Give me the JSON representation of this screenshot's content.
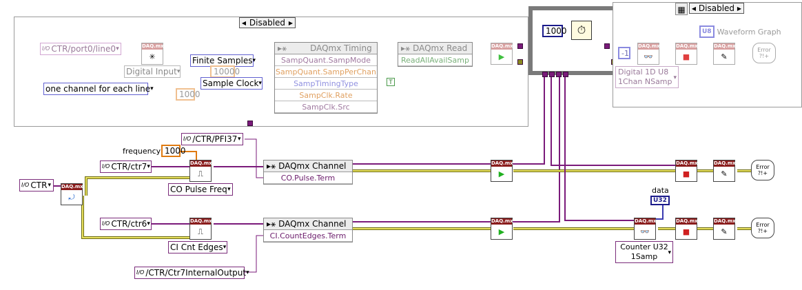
{
  "diagram_disable_structure_1": {
    "selector": "Disabled"
  },
  "diagram_disable_structure_2": {
    "selector": "Disabled"
  },
  "ctr_line": "CTR/port0/line0",
  "digital_input": "Digital Input",
  "one_channel": "one channel for each line",
  "finite_samples": "Finite Samples",
  "samples_per_chan": "10000",
  "sample_clock": "Sample Clock",
  "rate_const": "1000",
  "timing_node": {
    "title": "DAQmx Timing",
    "rows": [
      "SampQuant.SampMode",
      "SampQuant.SampPerChan",
      "SampTimingType",
      "SampClk.Rate",
      "SampClk.Src"
    ]
  },
  "read_node": {
    "title": "DAQmx Read",
    "rows": [
      "ReadAllAvailSamp"
    ]
  },
  "t_const": "T",
  "wait_const": "1000",
  "minus_one": "-1",
  "u8_label": "U8",
  "waveform_graph": "Waveform Graph",
  "digital_1d": [
    "Digital 1D U8",
    "1Chan NSamp"
  ],
  "pfi_const": "/CTR/PFI37",
  "frequency_label": "frequency",
  "frequency_value": "1000",
  "ctr7": "CTR/ctr7",
  "ctr6": "CTR/ctr6",
  "ctr_device": "CTR",
  "co_pulse_freq": "CO Pulse Freq",
  "ci_cnt_edges": "CI Cnt Edges",
  "channel_node_1": {
    "title": "DAQmx Channel",
    "rows": [
      "CO.Pulse.Term"
    ]
  },
  "channel_node_2": {
    "title": "DAQmx Channel",
    "rows": [
      "CI.CountEdges.Term"
    ]
  },
  "ctr7_internal": "/CTR/Ctr7InternalOutput",
  "data_label": "data",
  "data_type": "U32",
  "counter_u32": [
    "Counter U32",
    "1Samp"
  ],
  "daqmx_tag": "DAQ.mx",
  "error_text": [
    "Error",
    "?!+"
  ]
}
